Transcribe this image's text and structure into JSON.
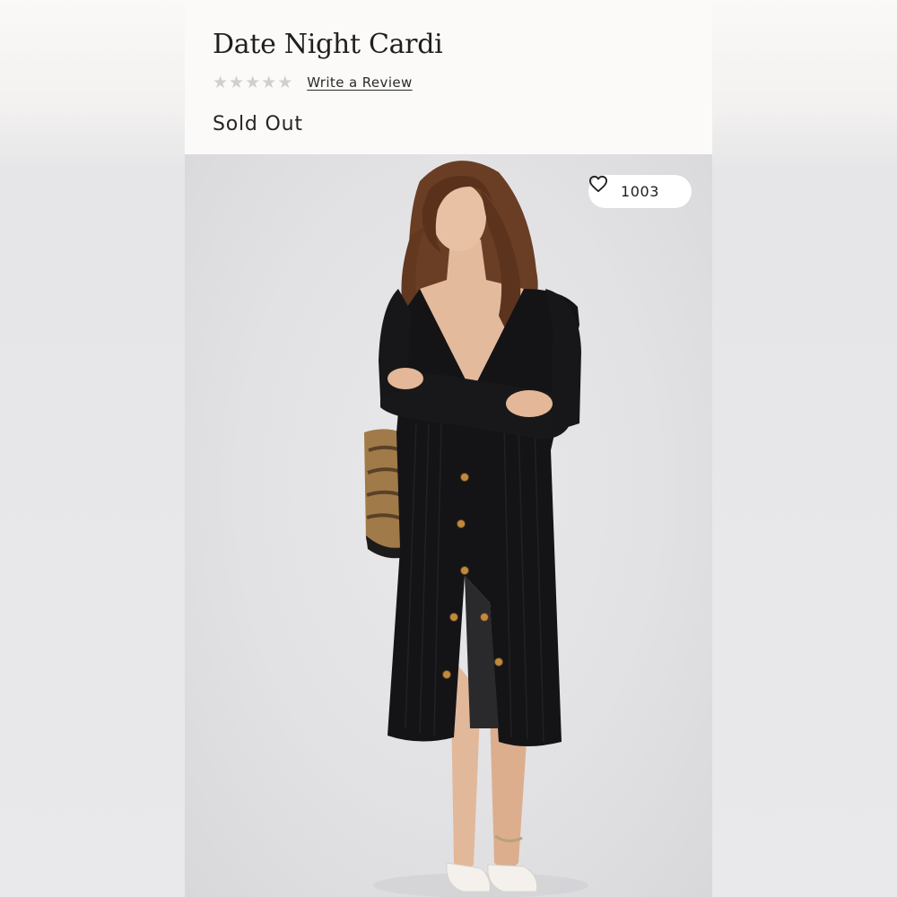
{
  "product": {
    "title": "Date Night Cardi",
    "rating": {
      "stars_filled": 0,
      "stars_total": 5
    },
    "review_link_label": "Write a Review",
    "availability": "Sold Out"
  },
  "image": {
    "description_icon": "product-photo",
    "favorites": {
      "count": "1003",
      "icon": "heart-icon"
    }
  },
  "colors": {
    "panel_bg": "#fcfaf8",
    "star_empty": "#cfcfcf",
    "garment": "#141416"
  }
}
